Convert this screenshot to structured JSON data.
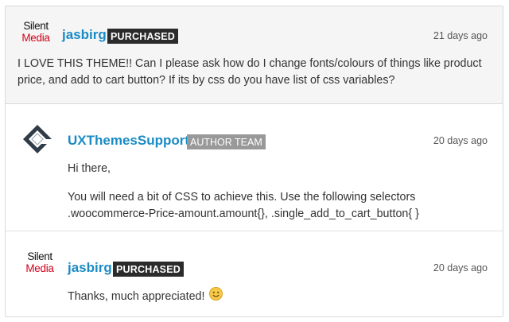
{
  "comments": [
    {
      "avatar_line1": "Silent",
      "avatar_line2": "Media",
      "username": "jasbirg",
      "badge": "PURCHASED",
      "date": "21 days ago",
      "text": "I LOVE THIS THEME!! Can I please ask how do I change fonts/colours of things like product price, and add to cart button? If its by css do you have list of css variables?"
    },
    {
      "username": "UXThemesSupport",
      "badge": "AUTHOR TEAM",
      "date": "20 days ago",
      "paragraph1": "Hi there,",
      "paragraph2": "You will need a bit of CSS to achieve this. Use the following selectors .woocommerce-Price-amount.amount{}, .single_add_to_cart_button{ }"
    },
    {
      "avatar_line1": "Silent",
      "avatar_line2": "Media",
      "username": "jasbirg",
      "badge": "PURCHASED",
      "date": "20 days ago",
      "text": "Thanks, much appreciated!",
      "emoji": "smiley-emoji"
    }
  ],
  "colors": {
    "username": "#1a8bc4",
    "badge_dark": "#2b2b2b",
    "badge_gray": "#999999",
    "avatar_red": "#d0021b"
  }
}
